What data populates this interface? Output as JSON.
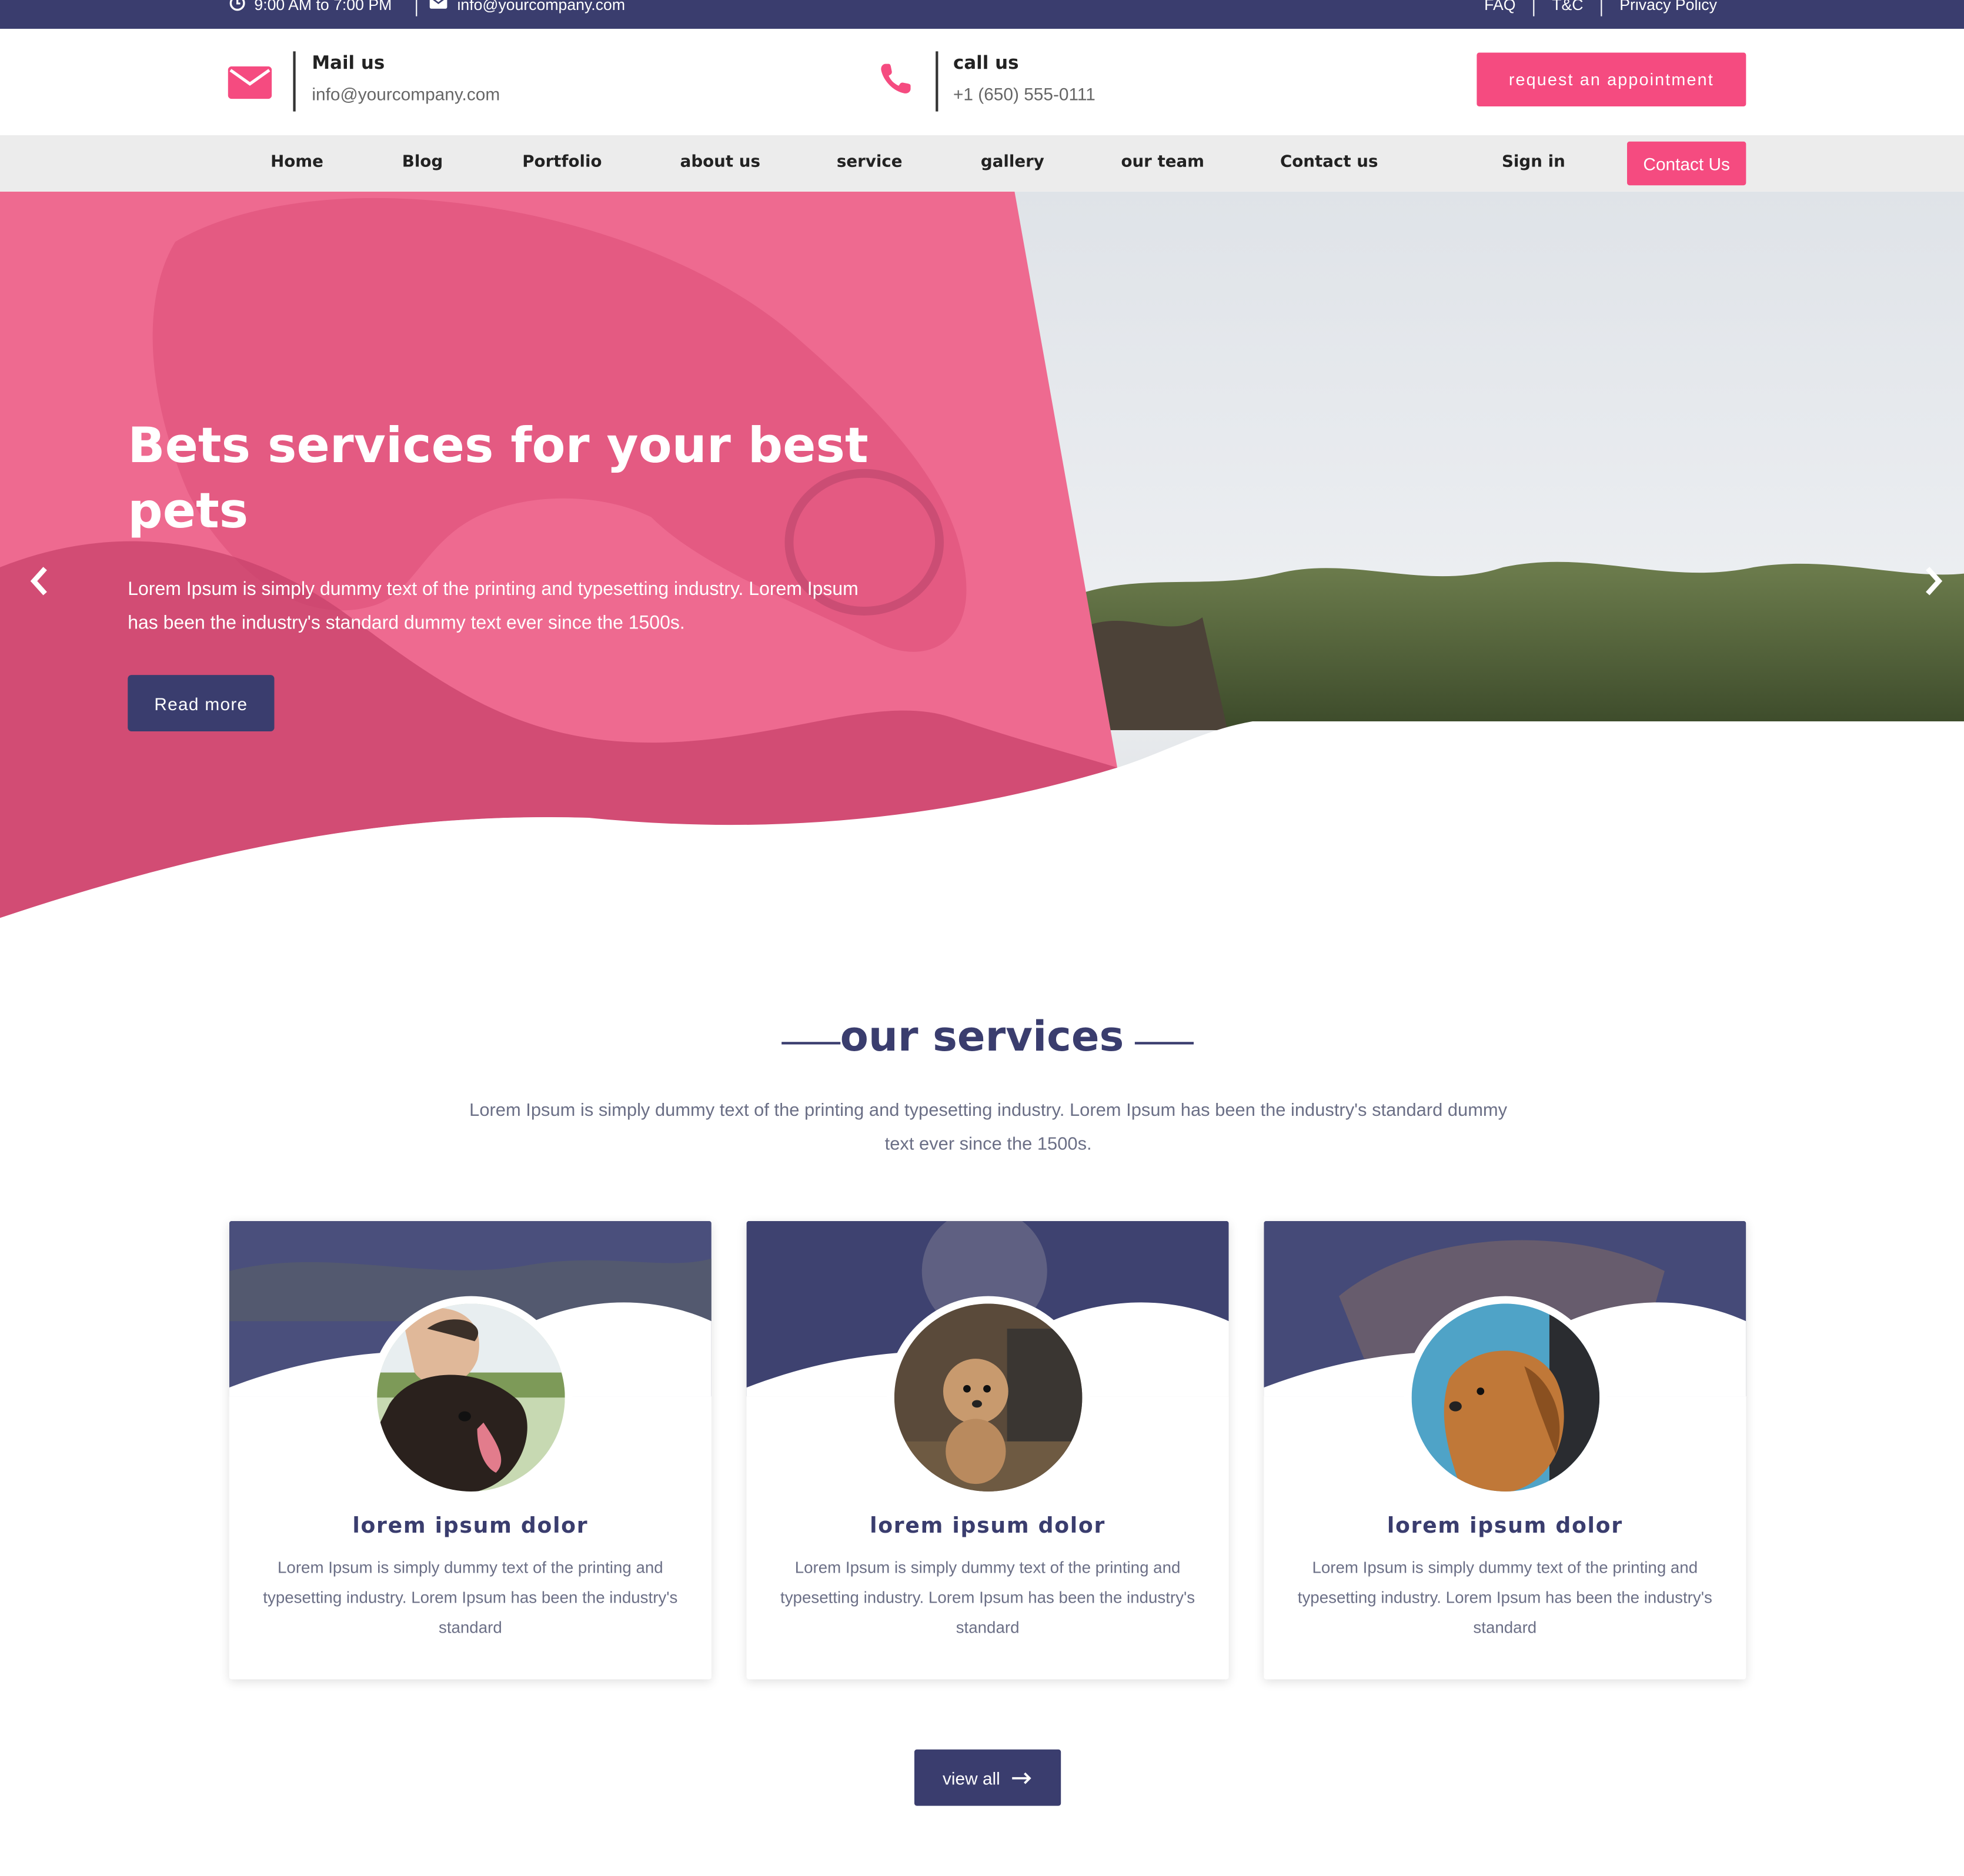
{
  "topbar": {
    "hours": "9:00 AM to 7:00 PM",
    "email": "info@yourcompany.com",
    "links": [
      "FAQ",
      "T&C",
      "Privacy Policy"
    ]
  },
  "header": {
    "mail_title": "Mail us",
    "mail_value": "info@yourcompany.com",
    "call_title": "call us",
    "call_value": "+1 (650) 555-0111",
    "appointment_label": "request an appointment"
  },
  "nav": {
    "items": [
      "Home",
      "Blog",
      "Portfolio",
      "about us",
      "service",
      "gallery",
      "our team",
      "Contact us"
    ],
    "signin": "Sign in",
    "contact_button": "Contact Us"
  },
  "hero": {
    "title": "Bets services for your best pets",
    "text": "Lorem Ipsum is simply dummy text of the printing and typesetting industry. Lorem Ipsum has been the industry's standard dummy text ever since the 1500s.",
    "button": "Read more",
    "prev_icon": "chevron-left-icon",
    "next_icon": "chevron-right-icon"
  },
  "services": {
    "title": "our services",
    "text": "Lorem Ipsum is simply dummy text of the printing and typesetting industry. Lorem Ipsum has been the industry's standard dummy text ever since the 1500s.",
    "cards": [
      {
        "title": "lorem ipsum dolor",
        "text": "Lorem Ipsum is simply dummy text of the printing and typesetting industry. Lorem Ipsum has been the industry's standard"
      },
      {
        "title": "lorem ipsum dolor",
        "text": "Lorem Ipsum is simply dummy text of the printing and typesetting industry. Lorem Ipsum has been the industry's standard"
      },
      {
        "title": "lorem ipsum dolor",
        "text": "Lorem Ipsum is simply dummy text of the printing and typesetting industry. Lorem Ipsum has been the industry's standard"
      }
    ],
    "view_all": "view all"
  },
  "colors": {
    "primary": "#3a3d6e",
    "accent": "#f54b80",
    "hero_overlay": "#ef5f86"
  }
}
